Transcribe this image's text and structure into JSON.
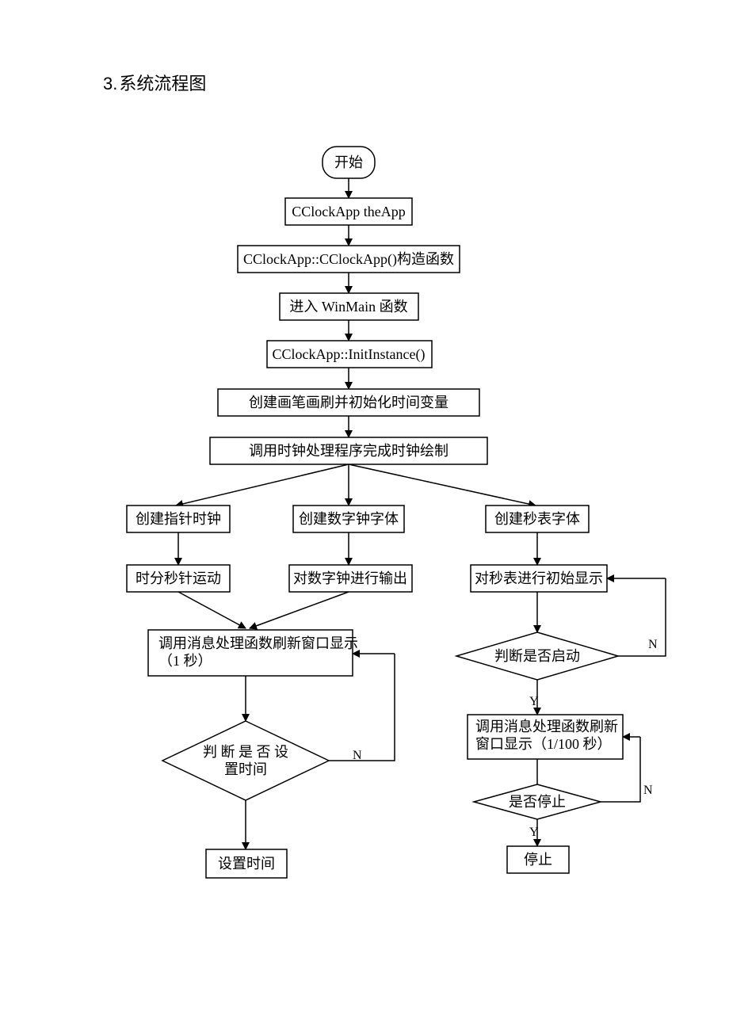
{
  "heading": {
    "number": "3.",
    "title": "系统流程图"
  },
  "nodes": {
    "start": "开始",
    "theApp": "CClockApp theApp",
    "ctor": "CClockApp::CClockApp()构造函数",
    "winmain": "进入 WinMain 函数",
    "init": "CClockApp::InitInstance()",
    "brush": "创建画笔画刷并初始化时间变量",
    "drawClock": "调用时钟处理程序完成时钟绘制",
    "ptrClock": "创建指针时钟",
    "digFont": "创建数字钟字体",
    "swFont": "创建秒表字体",
    "hands": "时分秒针运动",
    "digOut": "对数字钟进行输出",
    "swInit": "对秒表进行初始显示",
    "refresh1s_l1": "调用消息处理函数刷新窗口显示",
    "refresh1s_l2": "（1 秒）",
    "setTimeDec_l1": "判 断 是 否 设",
    "setTimeDec_l2": "置时间",
    "setTime": "设置时间",
    "swStarted": "判断是否启动",
    "refresh100_l1": "调用消息处理函数刷新",
    "refresh100_l2": "窗口显示（1/100 秒）",
    "swStopped": "是否停止",
    "stop": "停止"
  },
  "labels": {
    "Y": "Y",
    "N": "N"
  }
}
